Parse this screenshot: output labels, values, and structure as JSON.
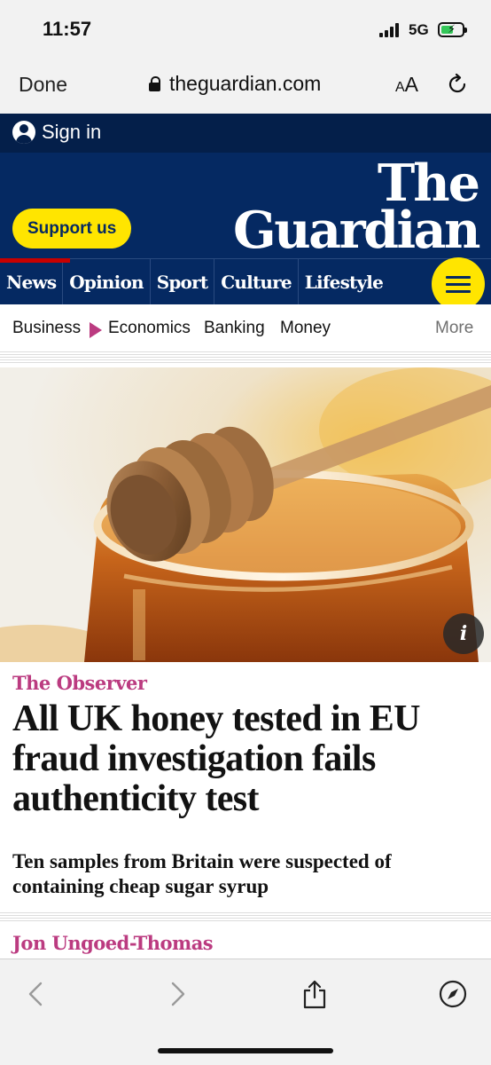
{
  "status_bar": {
    "time": "11:57",
    "network": "5G",
    "battery_level": 0.6,
    "battery_color": "#34c759"
  },
  "browser": {
    "done_label": "Done",
    "url": "theguardian.com",
    "text_size_small": "A",
    "text_size_large": "A",
    "lock_icon": "lock-icon",
    "reload_icon": "reload-icon"
  },
  "header": {
    "sign_in_label": "Sign in",
    "logo_line1": "The",
    "logo_line2": "Guardian",
    "support_label": "Support us",
    "nav_items": [
      "News",
      "Opinion",
      "Sport",
      "Culture",
      "Lifestyle"
    ],
    "menu_icon": "hamburger-menu-icon",
    "brand_color": "#052962",
    "accent_color": "#ffe500"
  },
  "subnav": {
    "items": [
      "Business",
      "Economics",
      "Banking",
      "Money"
    ],
    "more_label": "More"
  },
  "hero": {
    "info_label": "i"
  },
  "article": {
    "kicker": "The Observer",
    "headline": "All UK honey tested in EU fraud investigation fails authenticity test",
    "standfirst": "Ten samples from Britain were suspected of containing cheap sugar syrup",
    "byline": "Jon Ungoed-Thomas",
    "pillar_color": "#bb3b80"
  },
  "toolbar": {
    "back_icon": "back-chevron-icon",
    "forward_icon": "forward-chevron-icon",
    "share_icon": "share-icon",
    "safari_icon": "compass-icon"
  }
}
